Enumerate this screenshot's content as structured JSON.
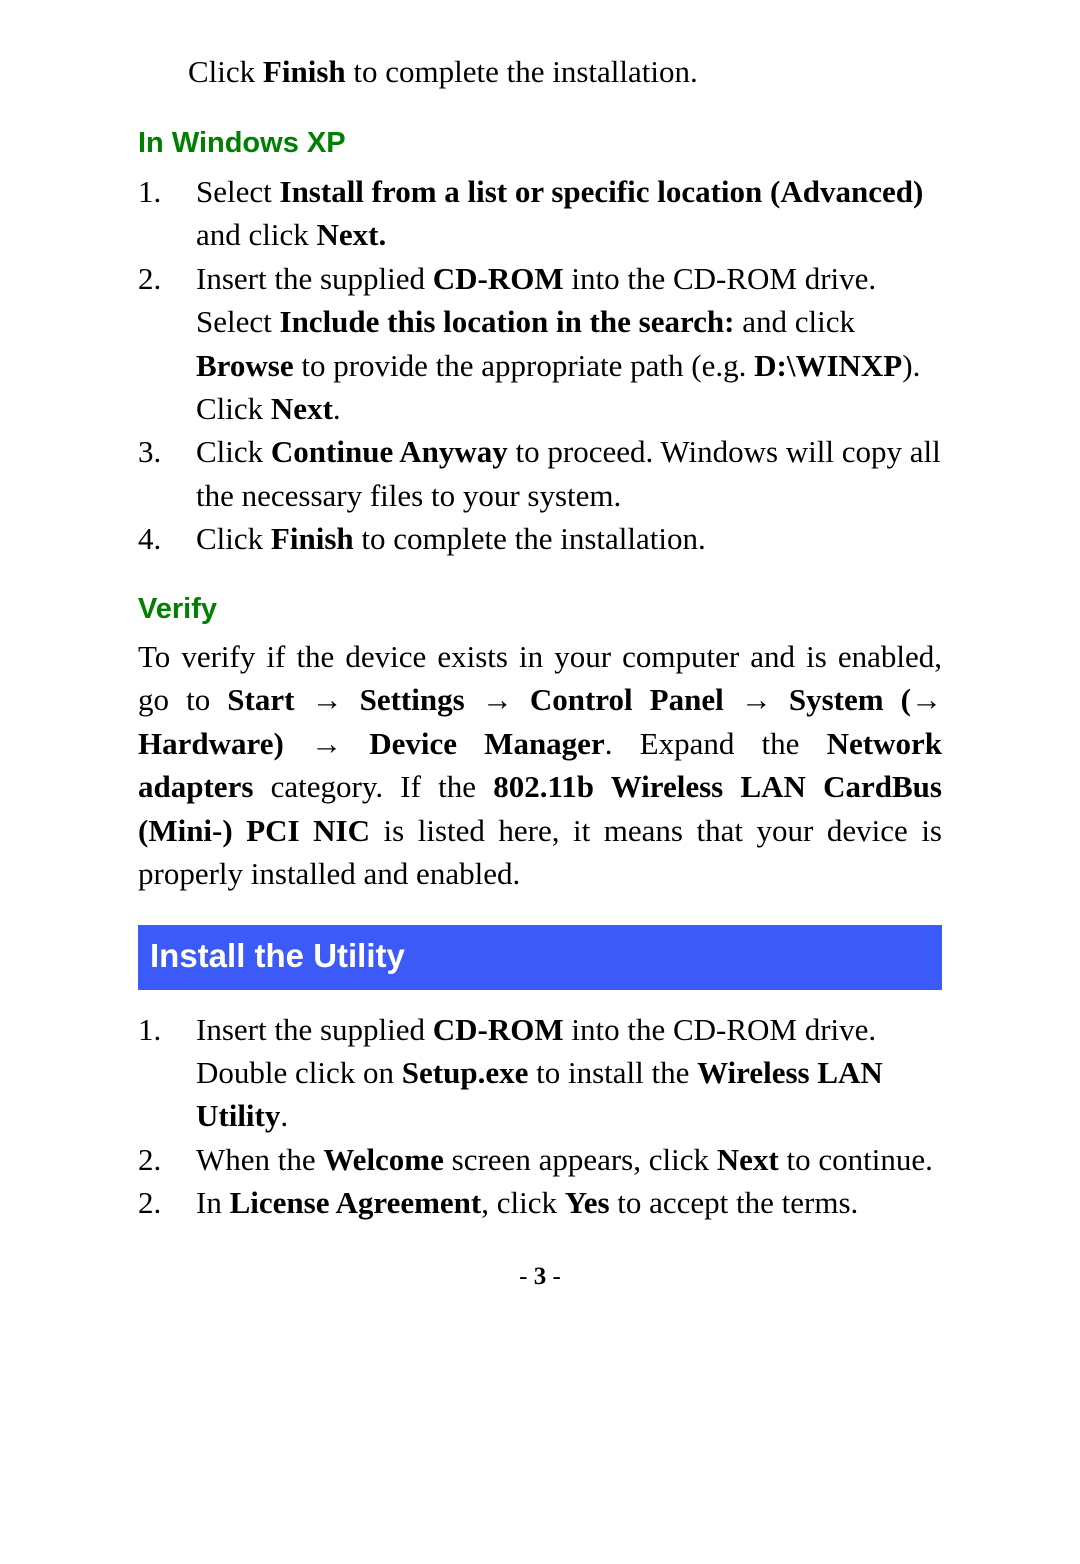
{
  "intro": {
    "prefix": "Click ",
    "finish": "Finish",
    "suffix": " to complete the installation."
  },
  "xp": {
    "heading": "In Windows XP",
    "items": [
      {
        "num": "1.",
        "t1": "Select ",
        "t2": "Install from a list or specific location (Advanced)",
        "t3": " and click ",
        "t4": "Next."
      },
      {
        "num": "2.",
        "t1": "Insert the supplied ",
        "t2": "CD-ROM",
        "t3": " into the CD-ROM drive. Select ",
        "t4": "Include this location in the search:",
        "t5": " and click ",
        "t6": "Browse",
        "t7": " to provide the appropriate path (e.g. ",
        "t8": "D:\\WINXP",
        "t9": "). Click ",
        "t10": "Next",
        "t11": "."
      },
      {
        "num": "3.",
        "t1": "Click ",
        "t2": "Continue Anyway",
        "t3": " to proceed. Windows will copy all the necessary files to your system."
      },
      {
        "num": "4.",
        "t1": "Click ",
        "t2": "Finish",
        "t3": " to complete the installation."
      }
    ]
  },
  "verify": {
    "heading": "Verify",
    "t1": "To verify if the device exists in your computer and is enabled, go to ",
    "start": "Start",
    "arrow": " → ",
    "settings": "Settings",
    "cp": "Control Panel",
    "system_open": "System (",
    "arrow_inside": "→",
    "hardware_close": " Hardware)",
    "dm": "Device Manager",
    "t2": ". Expand the ",
    "na": "Network adapters",
    "t3": " category. If the ",
    "nic": "802.11b Wireless LAN CardBus (Mini-) PCI NIC",
    "t4": " is listed here, it means that your device is properly installed and enabled."
  },
  "install_utility": {
    "heading": "Install the Utility",
    "items": [
      {
        "num": "1.",
        "t1": "Insert the supplied ",
        "t2": "CD-ROM",
        "t3": " into the CD-ROM drive. Double click on ",
        "t4": "Setup.exe",
        "t5": " to install the ",
        "t6": "Wireless LAN Utility",
        "t7": "."
      },
      {
        "num": "2.",
        "t1": "When the ",
        "t2": "Welcome",
        "t3": " screen appears, click ",
        "t4": "Next",
        "t5": " to continue."
      },
      {
        "num": "2.",
        "t1": "In ",
        "t2": "License Agreement",
        "t3": ", click ",
        "t4": "Yes",
        "t5": " to accept the terms."
      }
    ]
  },
  "footer": {
    "dash1": "- ",
    "page": "3",
    "dash2": " -"
  }
}
